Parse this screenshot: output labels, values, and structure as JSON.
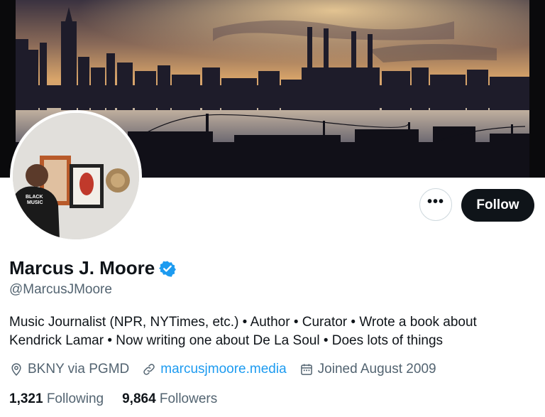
{
  "profile": {
    "name": "Marcus J. Moore",
    "handle": "@MarcusJMoore",
    "bio_line1": "Music Journalist (NPR, NYTimes, etc.) • Author • Curator • Wrote a book about",
    "bio_line2": "Kendrick Lamar • Now writing one about De La Soul • Does lots of things",
    "verified": true
  },
  "meta": {
    "location": "BKNY via PGMD",
    "website": "marcusjmoore.media",
    "joined": "Joined August 2009"
  },
  "stats": {
    "following_count": "1,321",
    "following_label": "Following",
    "followers_count": "9,864",
    "followers_label": "Followers"
  },
  "actions": {
    "more_label": "•••",
    "follow_label": "Follow"
  },
  "icons": {
    "location": "location-pin-icon",
    "link": "link-icon",
    "calendar": "calendar-icon",
    "verified": "verified-badge-icon",
    "more": "more-options-icon"
  },
  "colors": {
    "accent": "#1d9bf0",
    "text_primary": "#0f1419",
    "text_secondary": "#536471",
    "follow_button": "#0f1419"
  }
}
